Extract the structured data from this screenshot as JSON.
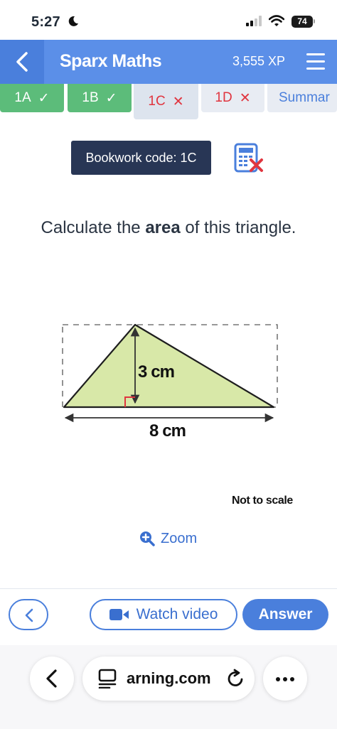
{
  "status_bar": {
    "time": "5:27",
    "battery": "74"
  },
  "header": {
    "title": "Sparx Maths",
    "xp": "3,555 XP"
  },
  "tabs": [
    {
      "label": "1A",
      "mark": "✓",
      "state": "done"
    },
    {
      "label": "1B",
      "mark": "✓",
      "state": "done"
    },
    {
      "label": "1C",
      "mark": "✕",
      "state": "wrong-active"
    },
    {
      "label": "1D",
      "mark": "✕",
      "state": "wrong"
    },
    {
      "label": "Summar",
      "mark": "",
      "state": "summary"
    }
  ],
  "bookwork": {
    "label": "Bookwork code: 1C"
  },
  "question": {
    "before": "Calculate the ",
    "bold": "area",
    "after": " of this triangle."
  },
  "diagram": {
    "height_label": "3 cm",
    "base_label": "8 cm",
    "fill_color": "#d8e8a8",
    "note": "Not to scale"
  },
  "zoom": {
    "label": "Zoom"
  },
  "actions": {
    "watch_video": "Watch video",
    "answer": "Answer"
  },
  "browser": {
    "url": "arning.com"
  },
  "colors": {
    "brand_blue": "#5b8fe8",
    "done_green": "#5cbc7a",
    "wrong_red": "#e0353f",
    "bookwork_navy": "#283655"
  },
  "icons": {
    "moon": "moon-icon",
    "signal": "signal-icon",
    "wifi": "wifi-icon",
    "back": "chevron-left-icon",
    "menu": "hamburger-menu-icon",
    "calculator": "calculator-cross-icon",
    "zoom": "zoom-plus-icon",
    "video": "video-camera-icon",
    "reload": "reload-icon",
    "more": "more-dots-icon"
  }
}
